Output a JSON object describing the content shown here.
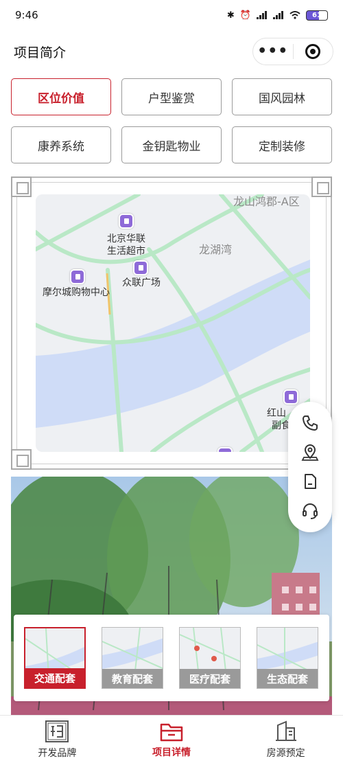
{
  "status_bar": {
    "time": "9:46",
    "battery": "61"
  },
  "header": {
    "title": "项目简介",
    "more_icon": "more-dots-icon",
    "target_icon": "target-icon"
  },
  "tabs": [
    {
      "label": "区位价值",
      "active": true
    },
    {
      "label": "户型鉴赏",
      "active": false
    },
    {
      "label": "国风园林",
      "active": false
    },
    {
      "label": "康养系统",
      "active": false
    },
    {
      "label": "金钥匙物业",
      "active": false
    },
    {
      "label": "定制装修",
      "active": false
    }
  ],
  "map": {
    "labels": {
      "area_a": "龙山鸿郡-A区",
      "beijing_hualian_1": "北京华联",
      "beijing_hualian_2": "生活超市",
      "longhuwan": "龙湖湾",
      "zhonglian": "众联广场",
      "moer": "摩尔城购物中心",
      "hongshan_1": "红山",
      "hongshan_2": "副食"
    },
    "colors": {
      "water": "#cfdcf7",
      "road": "#b9e8c6",
      "land": "#eef0f3",
      "poi": "#8e6ad8"
    }
  },
  "fab": [
    {
      "icon": "phone-icon"
    },
    {
      "icon": "location-pin-icon"
    },
    {
      "icon": "document-icon"
    },
    {
      "icon": "headset-icon"
    }
  ],
  "thumbs": [
    {
      "label": "交通配套",
      "active": true
    },
    {
      "label": "教育配套",
      "active": false
    },
    {
      "label": "医疗配套",
      "active": false
    },
    {
      "label": "生态配套",
      "active": false
    }
  ],
  "bottom_nav": [
    {
      "label": "开发品牌",
      "icon": "brand-seal-icon",
      "active": false
    },
    {
      "label": "项目详情",
      "icon": "folder-icon",
      "active": true
    },
    {
      "label": "房源预定",
      "icon": "building-icon",
      "active": false
    }
  ],
  "accent_color": "#c8202c"
}
